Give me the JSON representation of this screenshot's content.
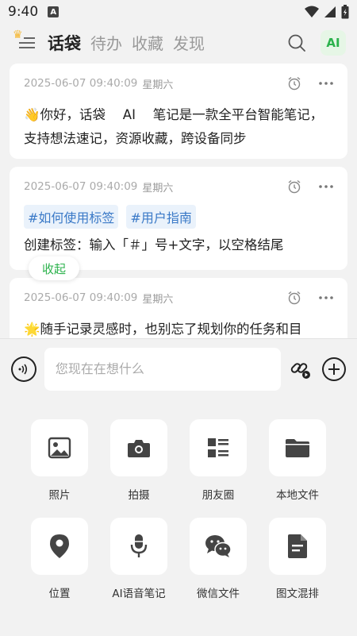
{
  "status": {
    "time": "9:40",
    "app_badge": "A"
  },
  "header": {
    "tabs": [
      {
        "label": "话袋",
        "active": true
      },
      {
        "label": "待办",
        "active": false
      },
      {
        "label": "收藏",
        "active": false
      },
      {
        "label": "发现",
        "active": false
      }
    ],
    "ai_label": "AI"
  },
  "feed": {
    "cards": [
      {
        "time": "2025-06-07 09:40:09",
        "weekday": "星期六",
        "text": "👋你好，话袋　 AI　 笔记是一款全平台智能笔记，支持想法速记，资源收藏，跨设备同步"
      },
      {
        "time": "2025-06-07 09:40:09",
        "weekday": "星期六",
        "tags": [
          "#如何使用标签",
          "#用户指南"
        ],
        "text": "创建标签：输入「＃」号+文字，以空格结尾"
      },
      {
        "time": "2025-06-07 09:40:09",
        "weekday": "星期六",
        "text": "🌟随手记录灵感时，也别忘了规划你的任务和目"
      }
    ],
    "collapse_label": "收起"
  },
  "composer": {
    "placeholder": "您现在在想什么"
  },
  "attach_panel": {
    "items": [
      {
        "label": "照片",
        "icon": "photo-icon"
      },
      {
        "label": "拍摄",
        "icon": "camera-icon"
      },
      {
        "label": "朋友圈",
        "icon": "moments-icon"
      },
      {
        "label": "本地文件",
        "icon": "folder-icon"
      },
      {
        "label": "位置",
        "icon": "location-icon"
      },
      {
        "label": "AI语音笔记",
        "icon": "microphone-icon"
      },
      {
        "label": "微信文件",
        "icon": "wechat-icon"
      },
      {
        "label": "图文混排",
        "icon": "document-icon"
      }
    ]
  },
  "colors": {
    "accent_green": "#2bb24c",
    "tag_blue": "#3a79c7",
    "background": "#f2f2f2"
  }
}
